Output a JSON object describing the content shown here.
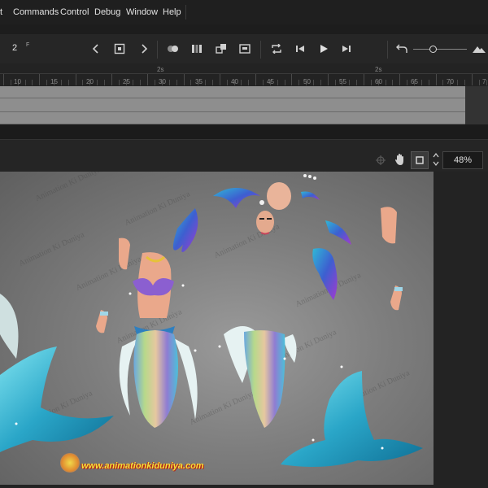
{
  "menu": {
    "items": [
      "t",
      "Commands",
      "Control",
      "Debug",
      "Window",
      "Help"
    ]
  },
  "timeline": {
    "current_frame": "2",
    "frame_suffix": "F",
    "ruler_seconds": [
      "2s",
      "2s"
    ],
    "ruler_frames": [
      "10",
      "15",
      "20",
      "25",
      "30",
      "35",
      "40",
      "45",
      "50",
      "55",
      "60",
      "65",
      "70",
      "7"
    ]
  },
  "stage": {
    "zoom": "48%",
    "watermark": "Animation Ki Duniya",
    "logo_url": "www.animationkiduniya.com"
  },
  "colors": {
    "accent_teal": "#2fb8d6",
    "background": "#1d1d1d"
  }
}
